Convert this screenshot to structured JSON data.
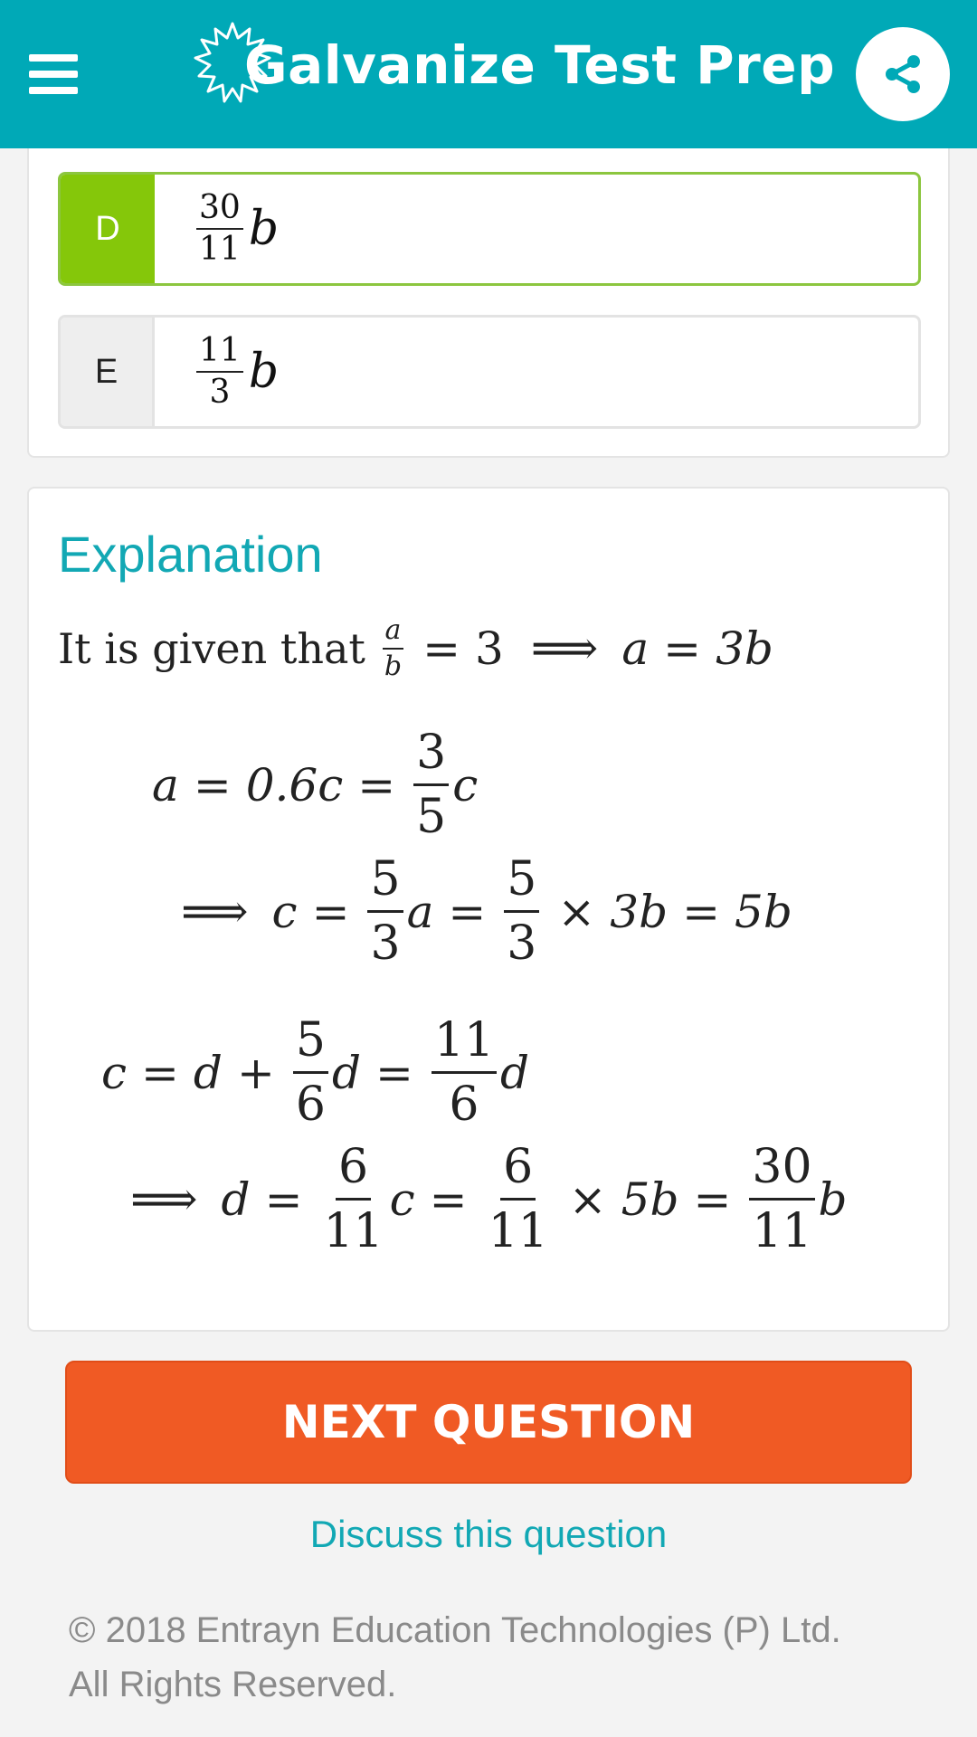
{
  "header": {
    "title": "Galvanize Test Prep",
    "menu_icon": "menu-icon",
    "share_icon": "share-icon",
    "background": "#00a9b7"
  },
  "options": [
    {
      "letter": "D",
      "numerator": "30",
      "denominator": "11",
      "variable": "b",
      "state": "correct",
      "accent": "#85c70a"
    },
    {
      "letter": "E",
      "numerator": "11",
      "denominator": "3",
      "variable": "b",
      "state": "default"
    }
  ],
  "explanation": {
    "title": "Explanation",
    "intro_text": "It is given that",
    "line1": {
      "frac_num": "a",
      "frac_den": "b",
      "eq": "=",
      "rhs": "3",
      "implies": "⟹",
      "result_lhs": "a",
      "result_eq": "=",
      "result_rhs": "3b"
    },
    "line2": {
      "lhs": "a",
      "eq1": "=",
      "mid": "0.6c",
      "eq2": "=",
      "frac_num": "3",
      "frac_den": "5",
      "tail": "c"
    },
    "line3": {
      "implies": "⟹",
      "lhs": "c",
      "eq1": "=",
      "frac1_num": "5",
      "frac1_den": "3",
      "mid": "a",
      "eq2": "=",
      "frac2_num": "5",
      "frac2_den": "3",
      "times": "×",
      "prod": "3b",
      "eq3": "=",
      "result": "5b"
    },
    "line4": {
      "lhs": "c",
      "eq1": "=",
      "d1": "d",
      "plus": "+",
      "frac1_num": "5",
      "frac1_den": "6",
      "d2": "d",
      "eq2": "=",
      "frac2_num": "11",
      "frac2_den": "6",
      "d3": "d"
    },
    "line5": {
      "implies": "⟹",
      "lhs": "d",
      "eq1": "=",
      "frac1_num": "6",
      "frac1_den": "11",
      "mid": "c",
      "eq2": "=",
      "frac2_num": "6",
      "frac2_den": "11",
      "times": "×",
      "prod": "5b",
      "eq3": "=",
      "frac3_num": "30",
      "frac3_den": "11",
      "tail": "b"
    }
  },
  "actions": {
    "next_label": "NEXT QUESTION",
    "next_color": "#f05a24",
    "discuss_label": "Discuss this question"
  },
  "footer": {
    "copyright_line1": "© 2018 Entrayn Education Technologies (P) Ltd.",
    "copyright_line2": "All Rights Reserved."
  }
}
